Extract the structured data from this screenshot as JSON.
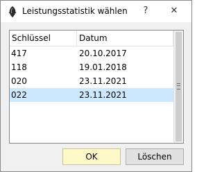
{
  "window": {
    "title": "Leistungsstatistik wählen",
    "help_glyph": "?",
    "close_glyph": "✕"
  },
  "table": {
    "columns": [
      "Schlüssel",
      "Datum"
    ],
    "rows": [
      {
        "key": "417",
        "date": "20.10.2017",
        "selected": false
      },
      {
        "key": "118",
        "date": "19.01.2018",
        "selected": false
      },
      {
        "key": "020",
        "date": "23.11.2021",
        "selected": false
      },
      {
        "key": "022",
        "date": "23.11.2021",
        "selected": true
      }
    ]
  },
  "buttons": {
    "ok_label": "OK",
    "delete_label": "Löschen"
  },
  "colors": {
    "selected_row": "#cce8ff",
    "ok_button": "#fff8c8",
    "icon": "#2b2b2b"
  },
  "icons": [
    "app-icon",
    "help-icon",
    "close-icon"
  ]
}
